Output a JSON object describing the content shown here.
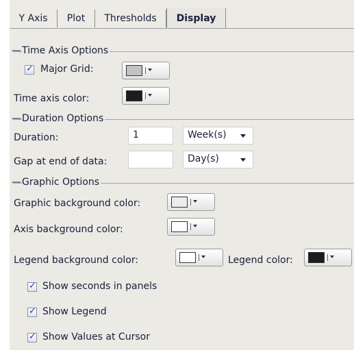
{
  "tabs": [
    {
      "label": "Y Axis"
    },
    {
      "label": "Plot"
    },
    {
      "label": "Thresholds"
    },
    {
      "label": "Display",
      "active": true
    }
  ],
  "time_axis": {
    "group_title": "Time Axis Options",
    "major_grid_label": "Major Grid:",
    "major_grid_checked": true,
    "major_grid_color": "#c3c3c3",
    "axis_color_label": "Time axis color:",
    "axis_color": "#1c1c1c"
  },
  "duration": {
    "group_title": "Duration Options",
    "duration_label": "Duration:",
    "duration_value": "1",
    "duration_unit": "Week(s)",
    "gap_label": "Gap at end of data:",
    "gap_value": "",
    "gap_unit": "Day(s)"
  },
  "graphic": {
    "group_title": "Graphic Options",
    "bg_label": "Graphic background color:",
    "bg_color": "#ececec",
    "axis_bg_label": "Axis background color:",
    "axis_bg_color": "#ffffff",
    "legend_bg_label": "Legend background color:",
    "legend_bg_color": "#ffffff",
    "legend_color_label": "Legend color:",
    "legend_color": "#1c1c1c"
  },
  "checkboxes": [
    {
      "label": "Show seconds in panels",
      "checked": true
    },
    {
      "label": "Show Legend",
      "checked": true
    },
    {
      "label": "Show Values at Cursor",
      "checked": true
    }
  ]
}
